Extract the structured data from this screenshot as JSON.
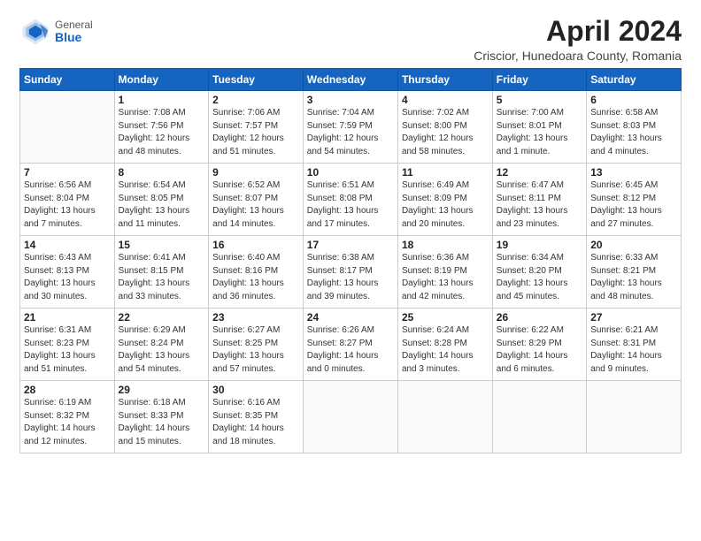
{
  "logo": {
    "general": "General",
    "blue": "Blue"
  },
  "title": "April 2024",
  "subtitle": "Criscior, Hunedoara County, Romania",
  "header_days": [
    "Sunday",
    "Monday",
    "Tuesday",
    "Wednesday",
    "Thursday",
    "Friday",
    "Saturday"
  ],
  "weeks": [
    [
      {
        "day": "",
        "info": ""
      },
      {
        "day": "1",
        "info": "Sunrise: 7:08 AM\nSunset: 7:56 PM\nDaylight: 12 hours\nand 48 minutes."
      },
      {
        "day": "2",
        "info": "Sunrise: 7:06 AM\nSunset: 7:57 PM\nDaylight: 12 hours\nand 51 minutes."
      },
      {
        "day": "3",
        "info": "Sunrise: 7:04 AM\nSunset: 7:59 PM\nDaylight: 12 hours\nand 54 minutes."
      },
      {
        "day": "4",
        "info": "Sunrise: 7:02 AM\nSunset: 8:00 PM\nDaylight: 12 hours\nand 58 minutes."
      },
      {
        "day": "5",
        "info": "Sunrise: 7:00 AM\nSunset: 8:01 PM\nDaylight: 13 hours\nand 1 minute."
      },
      {
        "day": "6",
        "info": "Sunrise: 6:58 AM\nSunset: 8:03 PM\nDaylight: 13 hours\nand 4 minutes."
      }
    ],
    [
      {
        "day": "7",
        "info": "Sunrise: 6:56 AM\nSunset: 8:04 PM\nDaylight: 13 hours\nand 7 minutes."
      },
      {
        "day": "8",
        "info": "Sunrise: 6:54 AM\nSunset: 8:05 PM\nDaylight: 13 hours\nand 11 minutes."
      },
      {
        "day": "9",
        "info": "Sunrise: 6:52 AM\nSunset: 8:07 PM\nDaylight: 13 hours\nand 14 minutes."
      },
      {
        "day": "10",
        "info": "Sunrise: 6:51 AM\nSunset: 8:08 PM\nDaylight: 13 hours\nand 17 minutes."
      },
      {
        "day": "11",
        "info": "Sunrise: 6:49 AM\nSunset: 8:09 PM\nDaylight: 13 hours\nand 20 minutes."
      },
      {
        "day": "12",
        "info": "Sunrise: 6:47 AM\nSunset: 8:11 PM\nDaylight: 13 hours\nand 23 minutes."
      },
      {
        "day": "13",
        "info": "Sunrise: 6:45 AM\nSunset: 8:12 PM\nDaylight: 13 hours\nand 27 minutes."
      }
    ],
    [
      {
        "day": "14",
        "info": "Sunrise: 6:43 AM\nSunset: 8:13 PM\nDaylight: 13 hours\nand 30 minutes."
      },
      {
        "day": "15",
        "info": "Sunrise: 6:41 AM\nSunset: 8:15 PM\nDaylight: 13 hours\nand 33 minutes."
      },
      {
        "day": "16",
        "info": "Sunrise: 6:40 AM\nSunset: 8:16 PM\nDaylight: 13 hours\nand 36 minutes."
      },
      {
        "day": "17",
        "info": "Sunrise: 6:38 AM\nSunset: 8:17 PM\nDaylight: 13 hours\nand 39 minutes."
      },
      {
        "day": "18",
        "info": "Sunrise: 6:36 AM\nSunset: 8:19 PM\nDaylight: 13 hours\nand 42 minutes."
      },
      {
        "day": "19",
        "info": "Sunrise: 6:34 AM\nSunset: 8:20 PM\nDaylight: 13 hours\nand 45 minutes."
      },
      {
        "day": "20",
        "info": "Sunrise: 6:33 AM\nSunset: 8:21 PM\nDaylight: 13 hours\nand 48 minutes."
      }
    ],
    [
      {
        "day": "21",
        "info": "Sunrise: 6:31 AM\nSunset: 8:23 PM\nDaylight: 13 hours\nand 51 minutes."
      },
      {
        "day": "22",
        "info": "Sunrise: 6:29 AM\nSunset: 8:24 PM\nDaylight: 13 hours\nand 54 minutes."
      },
      {
        "day": "23",
        "info": "Sunrise: 6:27 AM\nSunset: 8:25 PM\nDaylight: 13 hours\nand 57 minutes."
      },
      {
        "day": "24",
        "info": "Sunrise: 6:26 AM\nSunset: 8:27 PM\nDaylight: 14 hours\nand 0 minutes."
      },
      {
        "day": "25",
        "info": "Sunrise: 6:24 AM\nSunset: 8:28 PM\nDaylight: 14 hours\nand 3 minutes."
      },
      {
        "day": "26",
        "info": "Sunrise: 6:22 AM\nSunset: 8:29 PM\nDaylight: 14 hours\nand 6 minutes."
      },
      {
        "day": "27",
        "info": "Sunrise: 6:21 AM\nSunset: 8:31 PM\nDaylight: 14 hours\nand 9 minutes."
      }
    ],
    [
      {
        "day": "28",
        "info": "Sunrise: 6:19 AM\nSunset: 8:32 PM\nDaylight: 14 hours\nand 12 minutes."
      },
      {
        "day": "29",
        "info": "Sunrise: 6:18 AM\nSunset: 8:33 PM\nDaylight: 14 hours\nand 15 minutes."
      },
      {
        "day": "30",
        "info": "Sunrise: 6:16 AM\nSunset: 8:35 PM\nDaylight: 14 hours\nand 18 minutes."
      },
      {
        "day": "",
        "info": ""
      },
      {
        "day": "",
        "info": ""
      },
      {
        "day": "",
        "info": ""
      },
      {
        "day": "",
        "info": ""
      }
    ]
  ]
}
